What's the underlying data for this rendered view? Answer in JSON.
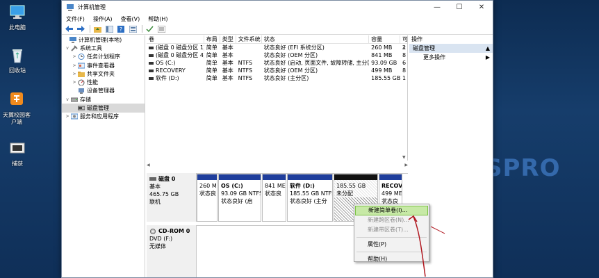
{
  "desktop": {
    "icons": [
      {
        "label": "此电脑"
      },
      {
        "label": "回收站"
      },
      {
        "label": "天翼校园客\n户端"
      },
      {
        "label": "捕获"
      }
    ],
    "watermark": "SPRO"
  },
  "window": {
    "title": "计算机管理",
    "controls": {
      "minimize": "—",
      "maximize": "☐",
      "close": "✕"
    },
    "menu": [
      "文件(F)",
      "操作(A)",
      "查看(V)",
      "帮助(H)"
    ]
  },
  "tree": {
    "items": [
      {
        "label": "计算机管理(本地)",
        "level": 0,
        "expander": "",
        "selected": false
      },
      {
        "label": "系统工具",
        "level": 1,
        "expander": "v",
        "selected": false
      },
      {
        "label": "任务计划程序",
        "level": 2,
        "expander": ">",
        "selected": false
      },
      {
        "label": "事件查看器",
        "level": 2,
        "expander": ">",
        "selected": false
      },
      {
        "label": "共享文件夹",
        "level": 2,
        "expander": ">",
        "selected": false
      },
      {
        "label": "性能",
        "level": 2,
        "expander": ">",
        "selected": false
      },
      {
        "label": "设备管理器",
        "level": 2,
        "expander": "",
        "selected": false
      },
      {
        "label": "存储",
        "level": 1,
        "expander": "v",
        "selected": false
      },
      {
        "label": "磁盘管理",
        "level": 2,
        "expander": "",
        "selected": true
      },
      {
        "label": "服务和应用程序",
        "level": 1,
        "expander": ">",
        "selected": false
      }
    ]
  },
  "volume_list": {
    "headers": [
      "卷",
      "布局",
      "类型",
      "文件系统",
      "状态",
      "容量",
      "可"
    ],
    "rows": [
      [
        "(磁盘 0 磁盘分区 1)",
        "简单",
        "基本",
        "",
        "状态良好 (EFI 系统分区)",
        "260 MB",
        "2"
      ],
      [
        "(磁盘 0 磁盘分区 4)",
        "简单",
        "基本",
        "",
        "状态良好 (OEM 分区)",
        "841 MB",
        "8"
      ],
      [
        "OS (C:)",
        "简单",
        "基本",
        "NTFS",
        "状态良好 (启动, 页面文件, 故障转储, 主分区)",
        "93.09 GB",
        "6"
      ],
      [
        "RECOVERY",
        "简单",
        "基本",
        "NTFS",
        "状态良好 (OEM 分区)",
        "499 MB",
        "8"
      ],
      [
        "软件 (D:)",
        "简单",
        "基本",
        "NTFS",
        "状态良好 (主分区)",
        "185.55 GB",
        "1"
      ]
    ]
  },
  "disks": [
    {
      "name": "磁盘 0",
      "type": "基本",
      "size": "465.75 GB",
      "status": "联机",
      "partitions": [
        {
          "line1": "",
          "line2": "260 M",
          "line3": "状态良",
          "style": "blue"
        },
        {
          "line1": "OS  (C:)",
          "line2": "93.09 GB NTFS",
          "line3": "状态良好 (启",
          "style": "blue"
        },
        {
          "line1": "",
          "line2": "841 ME",
          "line3": "状态良",
          "style": "blue"
        },
        {
          "line1": "软件  (D:)",
          "line2": "185.55 GB NTFS",
          "line3": "状态良好 (主分",
          "style": "blue"
        },
        {
          "line1": "",
          "line2": "185.55 GB",
          "line3": "未分配",
          "style": "unallocated"
        },
        {
          "line1": "RECOV",
          "line2": "499 ME",
          "line3": "状态良",
          "style": "blue"
        }
      ]
    },
    {
      "name": "CD-ROM 0",
      "type": "DVD (F:)",
      "size": "",
      "status": "无媒体",
      "partitions": []
    }
  ],
  "actions": {
    "header": "操作",
    "section": "磁盘管理",
    "items": [
      "更多操作"
    ]
  },
  "context_menu": {
    "items": [
      {
        "label": "新建简单卷(I)...",
        "state": "highlighted"
      },
      {
        "label": "新建跨区卷(N)...",
        "state": "disabled"
      },
      {
        "label": "新建带区卷(T)...",
        "state": "disabled"
      },
      {
        "label": "属性(P)",
        "state": "normal"
      },
      {
        "label": "帮助(H)",
        "state": "normal"
      }
    ]
  },
  "colors": {
    "partition_bar": "#1f3e9c",
    "highlight": "#c7e9a6",
    "annotation": "#b0161e"
  }
}
